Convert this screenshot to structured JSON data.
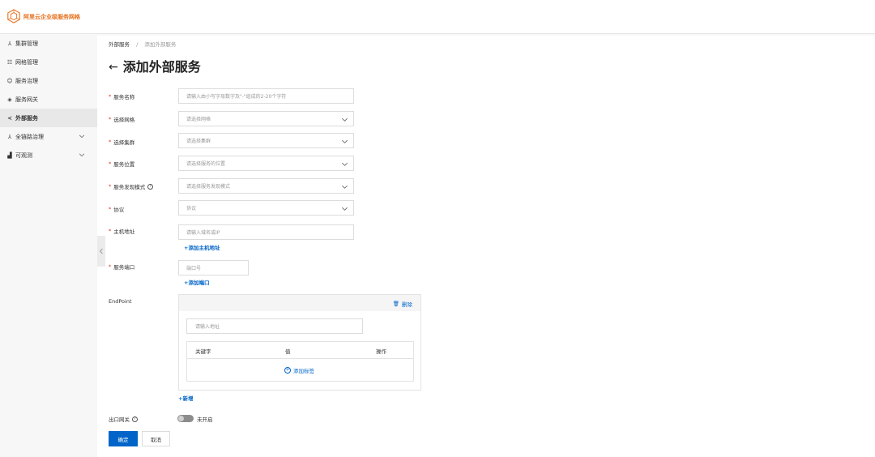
{
  "brand": {
    "name": "阿里云企业级服务网格",
    "logo_icon": "cube-logo-icon",
    "color": "#e6711f"
  },
  "sidebar": {
    "items": [
      {
        "label": "集群管理",
        "icon": "cluster-icon",
        "glyph": "⅄"
      },
      {
        "label": "网格管理",
        "icon": "grid-icon",
        "glyph": "☷"
      },
      {
        "label": "服务治理",
        "icon": "service-govern-icon",
        "glyph": "☺"
      },
      {
        "label": "服务网关",
        "icon": "gateway-icon",
        "glyph": "◈"
      },
      {
        "label": "外部服务",
        "icon": "share-icon",
        "glyph": "≺",
        "active": true
      },
      {
        "label": "全链路治理",
        "icon": "trace-icon",
        "glyph": "⅄",
        "expandable": true
      },
      {
        "label": "可观测",
        "icon": "chart-icon",
        "glyph": "▟",
        "expandable": true
      }
    ]
  },
  "breadcrumb": {
    "parent": "外部服务",
    "separator": "/",
    "current": "添加外部服务"
  },
  "page": {
    "back_glyph": "←",
    "title": "添加外部服务"
  },
  "form": {
    "service_name": {
      "label": "服务名称",
      "placeholder": "请输入由小写字母数字及\"-\"组成的2-20个字符"
    },
    "mesh": {
      "label": "选择网格",
      "placeholder": "请选择网格"
    },
    "cluster": {
      "label": "选择集群",
      "placeholder": "请选择集群"
    },
    "location": {
      "label": "服务位置",
      "placeholder": "请选择服务的位置"
    },
    "discovery": {
      "label": "服务发现模式",
      "help": "?",
      "placeholder": "请选择服务发现模式"
    },
    "protocol": {
      "label": "协议",
      "placeholder": "协议"
    },
    "host": {
      "label": "主机地址",
      "placeholder": "请输入域名或IP",
      "add_label": "+添加主机地址"
    },
    "port": {
      "label": "服务端口",
      "placeholder": "端口号",
      "add_label": "+添加端口"
    },
    "endpoint": {
      "label": "EndPoint",
      "delete_label": "删除",
      "delete_glyph": "🗑",
      "address_placeholder": "请输入地址",
      "columns": [
        "关键字",
        "值",
        "操作"
      ],
      "add_tag_label": "添加标签",
      "add_label": "+新增"
    },
    "egress": {
      "label": "出口网关",
      "help": "?",
      "toggle_state": "未开启",
      "enabled": false
    }
  },
  "actions": {
    "confirm": "确定",
    "cancel": "取消"
  },
  "colors": {
    "primary": "#0064c8",
    "required": "#d93026",
    "sidebar_bg": "#f7f7f7"
  }
}
